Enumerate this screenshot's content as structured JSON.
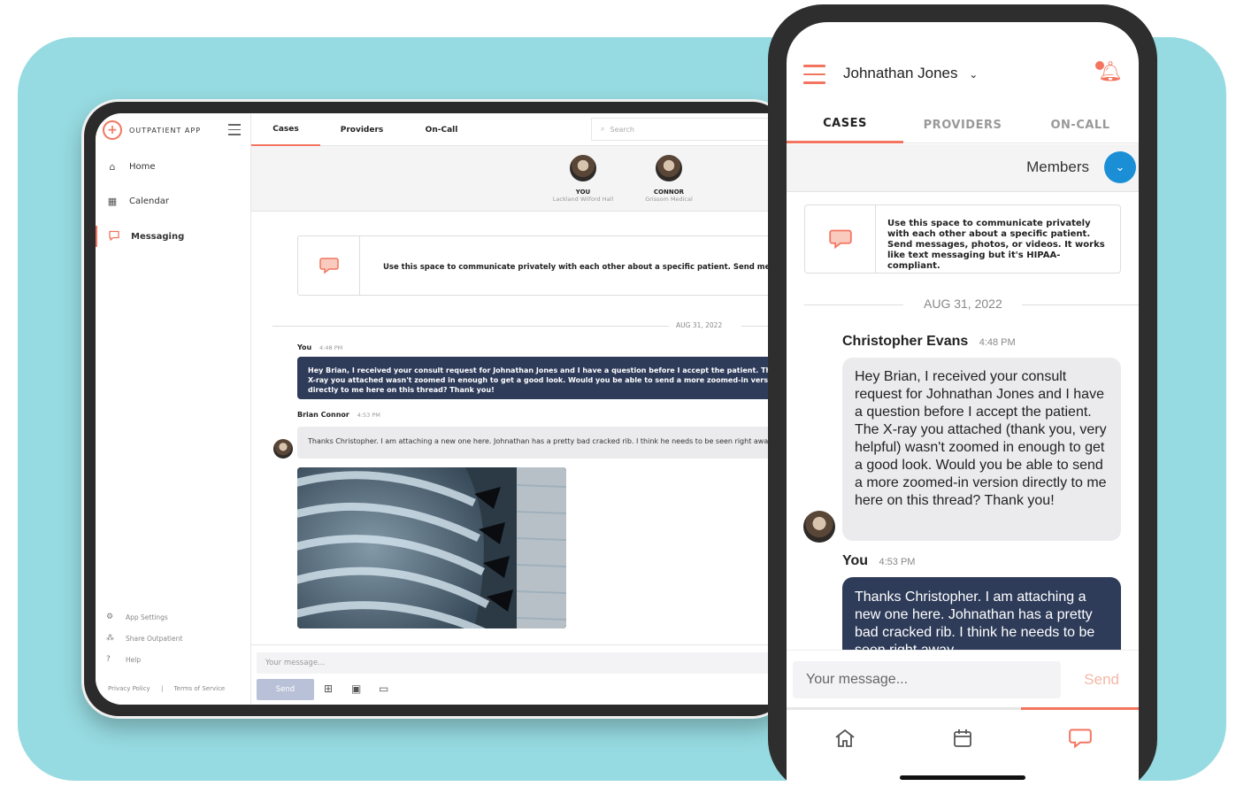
{
  "tablet": {
    "app_name": "OUTPATIENT APP",
    "nav": [
      {
        "label": "Home",
        "icon": "home-icon"
      },
      {
        "label": "Calendar",
        "icon": "calendar-icon"
      },
      {
        "label": "Messaging",
        "icon": "chat-icon",
        "active": true
      }
    ],
    "footer": [
      {
        "label": "App Settings",
        "icon": "gear-icon"
      },
      {
        "label": "Share Outpatient",
        "icon": "share-icon"
      },
      {
        "label": "Help",
        "icon": "help-icon"
      }
    ],
    "legal": {
      "privacy": "Privacy Policy",
      "sep": "|",
      "terms": "Terms of Service"
    },
    "tabs": [
      "Cases",
      "Providers",
      "On-Call"
    ],
    "search_placeholder": "Search",
    "members": [
      {
        "name": "YOU",
        "sub": "Lackland Wilford Hall"
      },
      {
        "name": "CONNOR",
        "sub": "Grissom Medical"
      }
    ],
    "info_text": "Use this space to communicate privately with each other about a specific patient. Send messages, photos, or videos.",
    "date": "AUG 31, 2022",
    "msg1": {
      "sender": "You",
      "time": "4:48 PM",
      "text": "Hey Brian, I received your consult request for Johnathan Jones and I have a question before I accept the patient. The X-ray you attached wasn't zoomed in enough to get a good look. Would you be able to send a more zoomed-in version directly to me here on this thread? Thank you!"
    },
    "msg2": {
      "sender": "Brian Connor",
      "time": "4:53 PM",
      "text": "Thanks Christopher. I am attaching a new one here. Johnathan has a pretty bad cracked rib. I think he needs to be seen right away."
    },
    "compose_placeholder": "Your message...",
    "send_label": "Send"
  },
  "phone": {
    "user": "Johnathan Jones",
    "tabs": [
      "CASES",
      "PROVIDERS",
      "ON-CALL"
    ],
    "members_label": "Members",
    "info_text": "Use this space to communicate privately with each other about a specific patient. Send messages, photos, or videos. It works like text messaging but it's HIPAA-compliant.",
    "date": "AUG 31, 2022",
    "msg1": {
      "sender": "Christopher Evans",
      "time": "4:48 PM",
      "text": "Hey Brian, I received your consult request for Johnathan Jones and I have a question before I accept the patient. The X-ray you attached (thank you, very helpful) wasn't zoomed in enough to get a good look. Would you be able to send a more zoomed-in version directly to me here on this thread? Thank you!"
    },
    "msg2": {
      "sender": "You",
      "time": "4:53 PM",
      "text": "Thanks Christopher. I am attaching a new one here. Johnathan has a pretty bad cracked rib. I think he needs to be seen right away."
    },
    "compose_placeholder": "Your message...",
    "send_label": "Send"
  },
  "colors": {
    "accent": "#f37560",
    "navy": "#2e3c5a",
    "teal_bg": "#96dbe1",
    "blue": "#1a8fd6"
  }
}
